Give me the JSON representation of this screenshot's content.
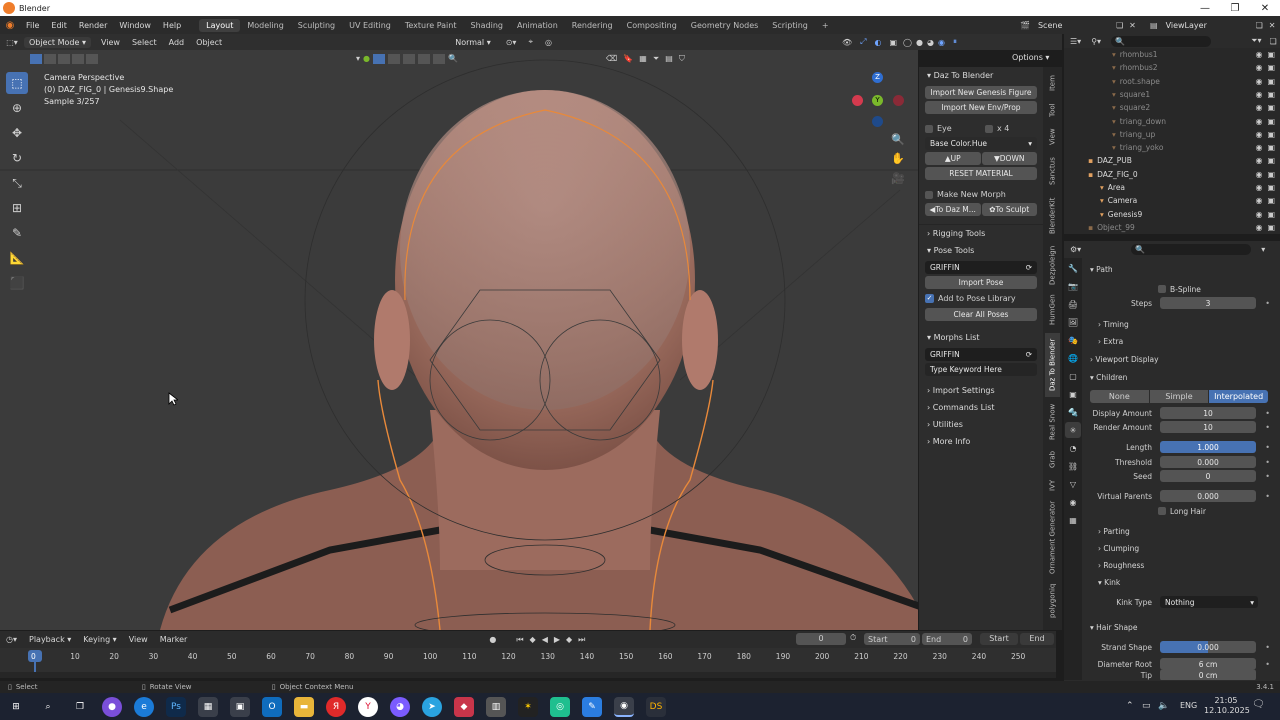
{
  "window": {
    "title": "Blender"
  },
  "menu": [
    "File",
    "Edit",
    "Render",
    "Window",
    "Help"
  ],
  "workspaces": [
    "Layout",
    "Modeling",
    "Sculpting",
    "UV Editing",
    "Texture Paint",
    "Shading",
    "Animation",
    "Rendering",
    "Compositing",
    "Geometry Nodes",
    "Scripting"
  ],
  "active_workspace": "Layout",
  "scene": {
    "name": "Scene",
    "view_layer": "ViewLayer"
  },
  "viewport_header": {
    "mode": "Object Mode",
    "view": "View",
    "select": "Select",
    "add": "Add",
    "object": "Object",
    "orientation": "Normal",
    "options": "Options"
  },
  "overlay": {
    "line1": "Camera Perspective",
    "line2": "(0) DAZ_FIG_0 | Genesis9.Shape",
    "line3": "Sample 3/257"
  },
  "gizmo": {
    "x": "X",
    "y": "Y",
    "z": "Z"
  },
  "npanel": {
    "header": "Daz To Blender",
    "import_figure": "Import New Genesis Figure",
    "import_env": "Import New Env/Prop",
    "eye": "Eye",
    "x4": "x 4",
    "base_color": "Base Color.Hue",
    "up": "UP",
    "down": "DOWN",
    "reset_material": "RESET MATERIAL",
    "make_new_morph": "Make New Morph",
    "to_daz": "To Daz M...",
    "to_sculpt": "To Sculpt",
    "rigging_tools": "Rigging Tools",
    "pose_tools": "Pose Tools",
    "pose_name": "GRIFFIN",
    "import_pose": "Import Pose",
    "add_to_pose_library": "Add to Pose Library",
    "clear_all_poses": "Clear All Poses",
    "morphs_list": "Morphs List",
    "morph_name": "GRIFFIN",
    "type_keyword": "Type Keyword Here",
    "import_settings": "Import Settings",
    "commands_list": "Commands List",
    "utilities": "Utilities",
    "more_info": "More Info"
  },
  "side_tabs": [
    "Item",
    "Tool",
    "View",
    "Sanctus",
    "BlenderKit",
    "Dezpoleign",
    "HumGen",
    "Daz To Blender",
    "Real Snow",
    "Grab",
    "IVY",
    "Ornament Generator",
    "polygoniq"
  ],
  "outliner": [
    {
      "name": "rhombus1",
      "indent": 3,
      "faded": true
    },
    {
      "name": "rhombus2",
      "indent": 3,
      "faded": true
    },
    {
      "name": "root.shape",
      "indent": 3,
      "faded": true
    },
    {
      "name": "square1",
      "indent": 3,
      "faded": true
    },
    {
      "name": "square2",
      "indent": 3,
      "faded": true
    },
    {
      "name": "triang_down",
      "indent": 3,
      "faded": true
    },
    {
      "name": "triang_up",
      "indent": 3,
      "faded": true
    },
    {
      "name": "triang_yoko",
      "indent": 3,
      "faded": true
    },
    {
      "name": "DAZ_PUB",
      "indent": 1,
      "faded": false
    },
    {
      "name": "DAZ_FIG_0",
      "indent": 1,
      "faded": false
    },
    {
      "name": "Area",
      "indent": 2,
      "faded": false
    },
    {
      "name": "Camera",
      "indent": 2,
      "faded": false
    },
    {
      "name": "Genesis9",
      "indent": 2,
      "faded": false
    },
    {
      "name": "Object_99",
      "indent": 1,
      "faded": true
    }
  ],
  "properties": {
    "path": "Path",
    "bspline": "B-Spline",
    "steps_label": "Steps",
    "steps": "3",
    "timing": "Timing",
    "extra": "Extra",
    "viewport_display": "Viewport Display",
    "children": "Children",
    "child_modes": [
      "None",
      "Simple",
      "Interpolated"
    ],
    "display_amount_label": "Display Amount",
    "display_amount": "10",
    "render_amount_label": "Render Amount",
    "render_amount": "10",
    "length_label": "Length",
    "length": "1.000",
    "threshold_label": "Threshold",
    "threshold": "0.000",
    "seed_label": "Seed",
    "seed": "0",
    "virtual_parents_label": "Virtual Parents",
    "virtual_parents": "0.000",
    "long_hair": "Long Hair",
    "parting": "Parting",
    "clumping": "Clumping",
    "roughness": "Roughness",
    "kink": "Kink",
    "kink_type_label": "Kink Type",
    "kink_type": "Nothing",
    "hair_shape": "Hair Shape",
    "strand_shape_label": "Strand Shape",
    "strand_shape": "0.000",
    "diameter_root_label": "Diameter Root",
    "diameter_root": "6 cm",
    "tip_label": "Tip",
    "tip": "0 cm"
  },
  "timeline": {
    "playback": "Playback",
    "keying": "Keying",
    "view": "View",
    "marker": "Marker",
    "current": "0",
    "start_label": "Start",
    "start": "0",
    "end_label": "End",
    "end": "0",
    "start_btn": "Start",
    "end_btn": "End",
    "frames": [
      "0",
      "10",
      "20",
      "30",
      "40",
      "50",
      "60",
      "70",
      "80",
      "90",
      "100",
      "110",
      "120",
      "130",
      "140",
      "150",
      "160",
      "170",
      "180",
      "190",
      "200",
      "210",
      "220",
      "230",
      "240",
      "250"
    ]
  },
  "status": {
    "select": "Select",
    "rotate": "Rotate View",
    "context": "Object Context Menu",
    "version": "3.4.1"
  },
  "taskbar": {
    "lang": "ENG",
    "time": "21:05",
    "date": "12.10.2025"
  }
}
